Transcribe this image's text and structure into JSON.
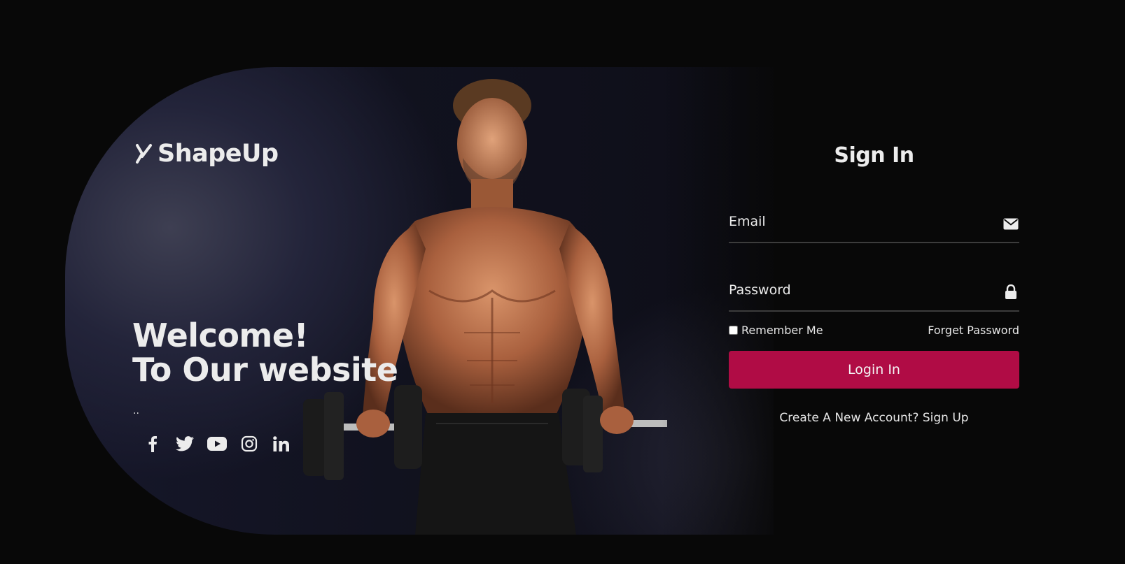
{
  "brand": {
    "name": "ShapeUp"
  },
  "hero": {
    "headline_line1": "Welcome!",
    "headline_line2": "To Our website",
    "tagline": "..",
    "socials": [
      {
        "icon": "facebook-icon"
      },
      {
        "icon": "twitter-icon"
      },
      {
        "icon": "youtube-icon"
      },
      {
        "icon": "instagram-icon"
      },
      {
        "icon": "linkedin-icon"
      }
    ]
  },
  "signin": {
    "title": "Sign In",
    "email_placeholder": "Email",
    "email_icon": "envelope-icon",
    "password_placeholder": "Password",
    "password_icon": "lock-icon",
    "remember_label": "Remember Me",
    "remember_checked": false,
    "forget_label": "Forget Password",
    "login_label": "Login In",
    "signup_text": "Create A New Account? Sign Up"
  },
  "colors": {
    "accent": "#b00c45",
    "background": "#080808",
    "text": "#ececec"
  }
}
